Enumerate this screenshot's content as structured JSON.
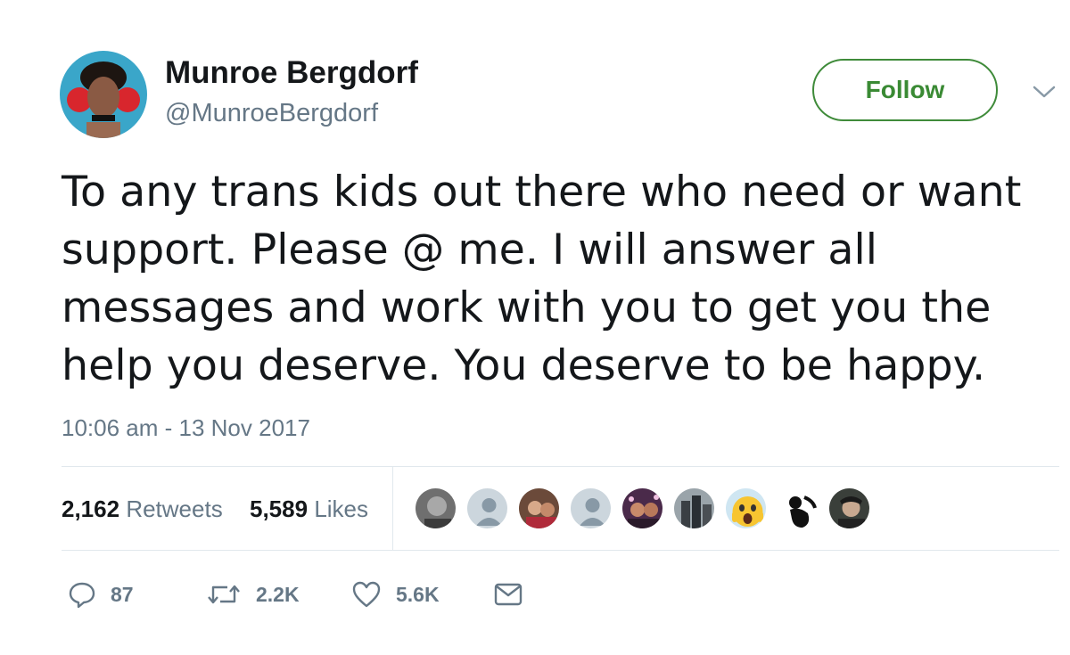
{
  "user": {
    "name": "Munroe Bergdorf",
    "handle": "@MunroeBergdorf"
  },
  "follow_button": {
    "label": "Follow"
  },
  "tweet": {
    "text": "To any trans kids out there who need or want\nsupport. Please @ me. I will answer all\nmessages and work with you to get you the\nhelp you deserve. You deserve to be happy.",
    "timestamp": "10:06 am - 13 Nov 2017"
  },
  "stats": {
    "retweets_count": "2,162",
    "retweets_label": "Retweets",
    "likes_count": "5,589",
    "likes_label": "Likes"
  },
  "actions": {
    "reply_count": "87",
    "retweet_count": "2.2K",
    "like_count": "5.6K"
  },
  "colors": {
    "follow_green": "#3f8b3a",
    "secondary_text": "#657786",
    "primary_text": "#14171a",
    "divider": "#e1e8ed"
  },
  "icons": [
    "chevron-down-icon",
    "reply-icon",
    "retweet-icon",
    "heart-icon",
    "envelope-icon"
  ]
}
